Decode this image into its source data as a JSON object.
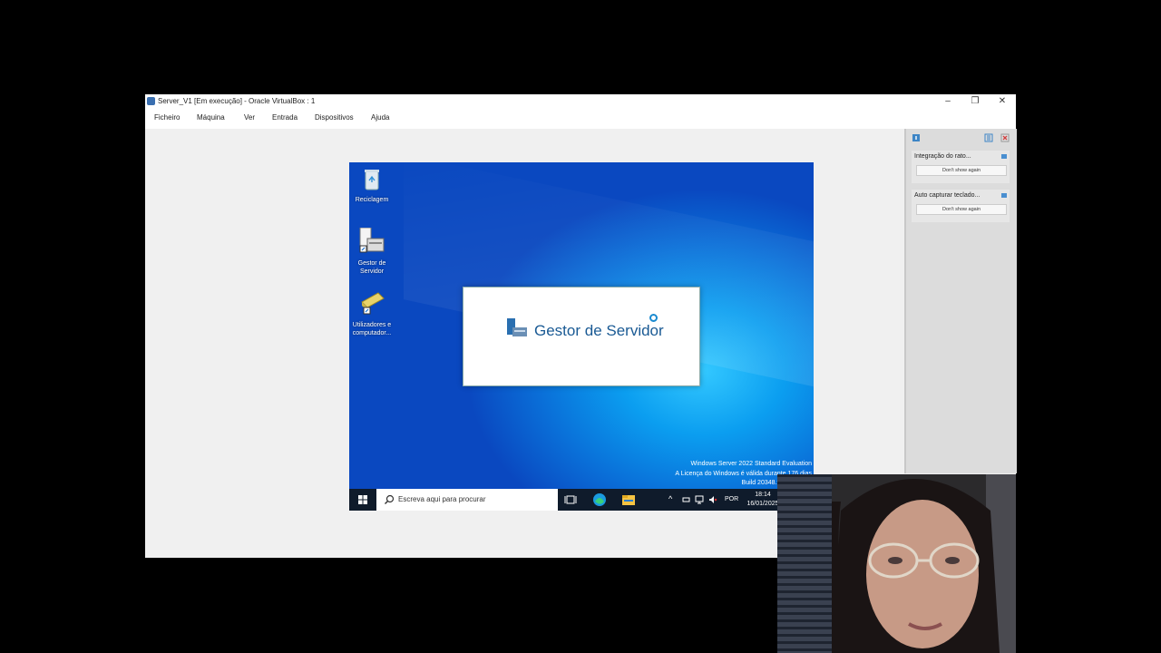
{
  "window": {
    "title": "Server_V1 [Em execução] - Oracle VirtualBox : 1",
    "controls": {
      "minimize": "–",
      "restore": "❐",
      "close": "✕"
    }
  },
  "menu": [
    "Ficheiro",
    "Máquina",
    "Ver",
    "Entrada",
    "Dispositivos",
    "Ajuda"
  ],
  "desktop": {
    "icons": [
      {
        "name": "recycle-bin",
        "label": "Reciclagem"
      },
      {
        "name": "server-manager",
        "label": "Gestor de Servidor"
      },
      {
        "name": "users-computers",
        "label": "Utilizadores e computador..."
      }
    ],
    "splash": {
      "title": "Gestor de Servidor"
    },
    "watermark": {
      "line1": "Windows Server 2022 Standard Evaluation",
      "line2": "A Licença do Windows é válida durante 176 dias",
      "line3": "Build 20348.fe_release.2"
    }
  },
  "taskbar": {
    "search_placeholder": "Escreva aqui para procurar",
    "language": "POR",
    "time": "18:14",
    "date": "16/01/2025"
  },
  "notifications": [
    {
      "text": "Integração do rato...",
      "button": "Don't show again"
    },
    {
      "text": "Auto capturar teclado...",
      "button": "Don't show again"
    }
  ],
  "colors": {
    "desktop_blue": "#0a6fd8",
    "taskbar": "#0f1b2b",
    "splash_text": "#1a5a94"
  }
}
